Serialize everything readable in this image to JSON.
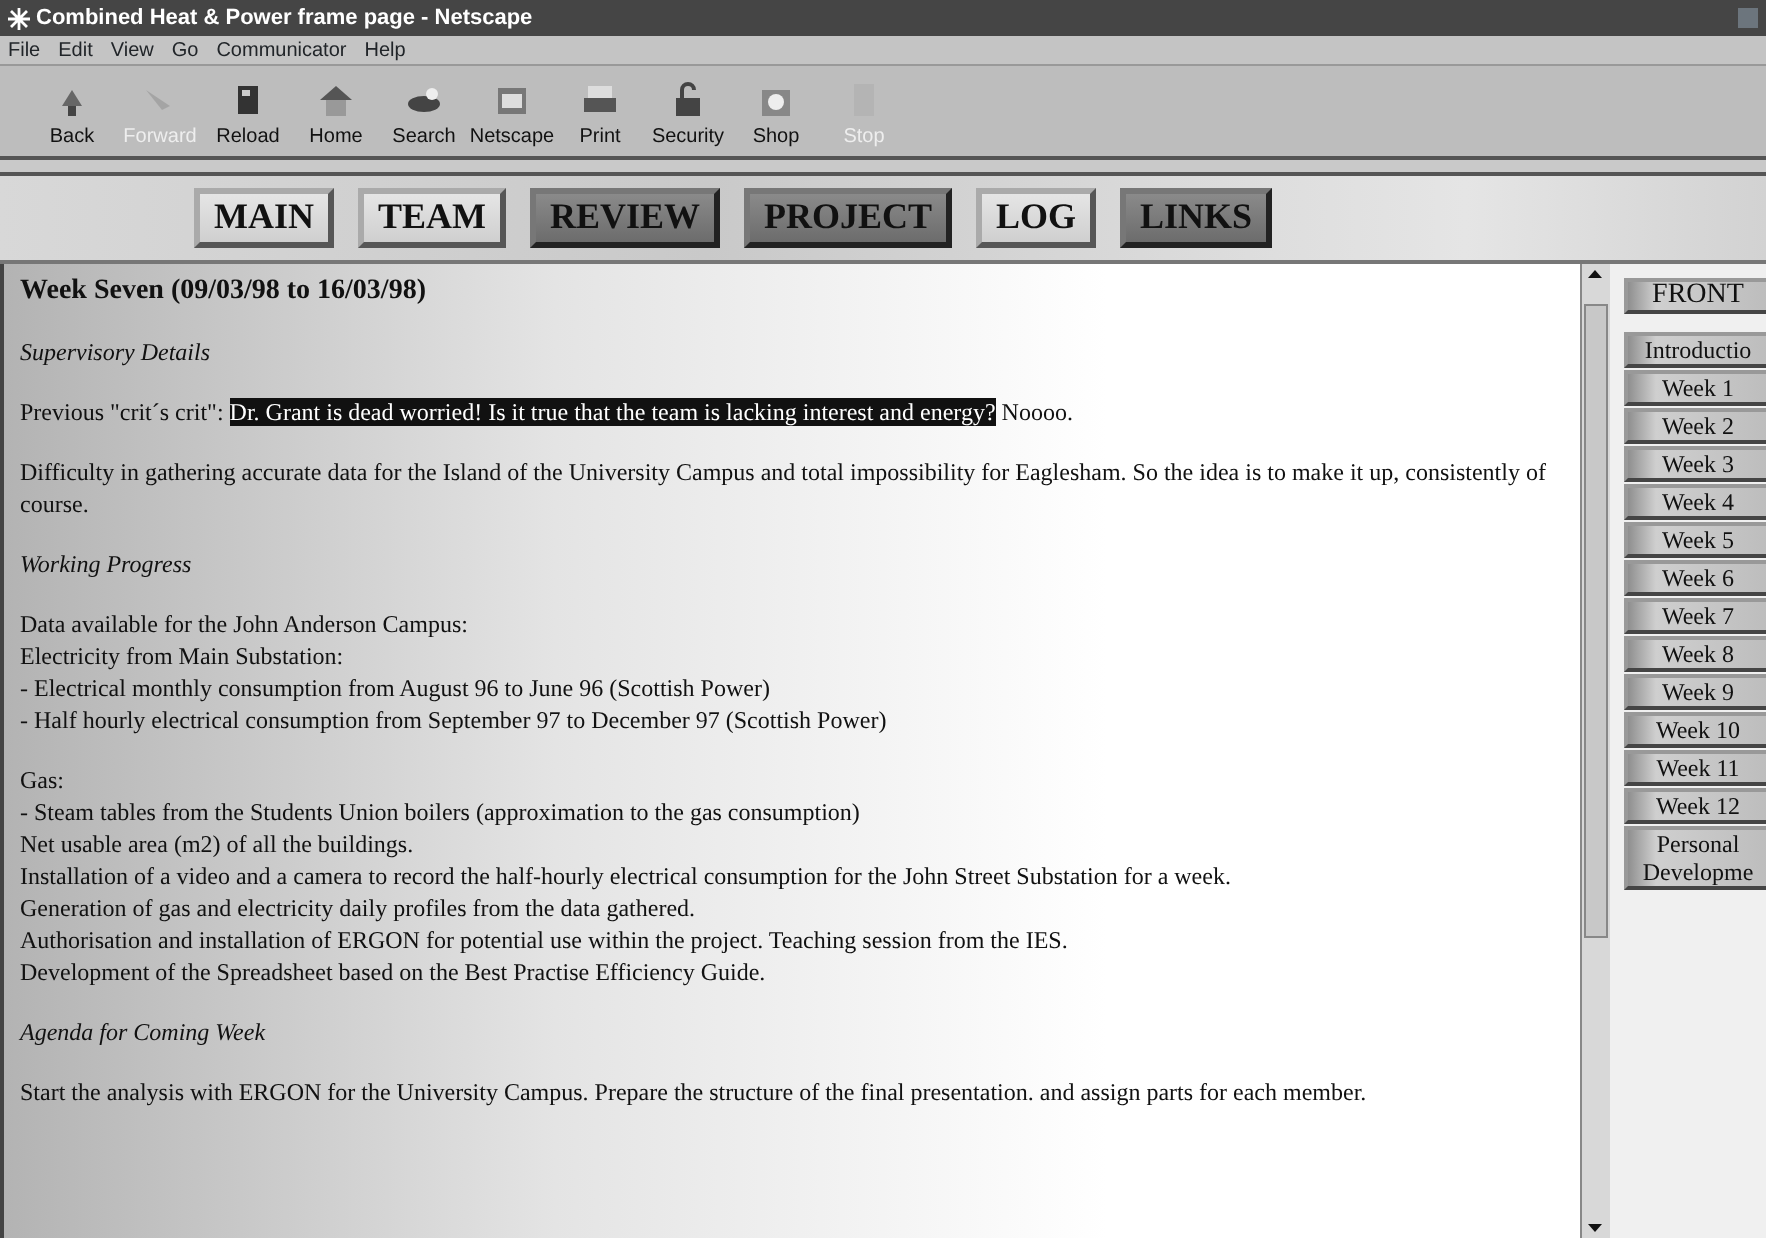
{
  "window": {
    "title": "Combined Heat & Power frame page - Netscape"
  },
  "menu": [
    "File",
    "Edit",
    "View",
    "Go",
    "Communicator",
    "Help"
  ],
  "toolbar": [
    {
      "label": "Back",
      "disabled": false
    },
    {
      "label": "Forward",
      "disabled": true
    },
    {
      "label": "Reload",
      "disabled": false
    },
    {
      "label": "Home",
      "disabled": false
    },
    {
      "label": "Search",
      "disabled": false
    },
    {
      "label": "Netscape",
      "disabled": false
    },
    {
      "label": "Print",
      "disabled": false
    },
    {
      "label": "Security",
      "disabled": false
    },
    {
      "label": "Shop",
      "disabled": false
    },
    {
      "label": "Stop",
      "disabled": true
    }
  ],
  "nav": [
    {
      "label": "MAIN",
      "kind": "light"
    },
    {
      "label": "TEAM",
      "kind": "light"
    },
    {
      "label": "REVIEW",
      "kind": "dark"
    },
    {
      "label": "PROJECT",
      "kind": "dark"
    },
    {
      "label": "LOG",
      "kind": "light"
    },
    {
      "label": "LINKS",
      "kind": "dark"
    }
  ],
  "content": [
    {
      "kind": "heading",
      "text": "Week Seven (09/03/98 to 16/03/98)"
    },
    {
      "kind": "subheading",
      "text": "Supervisory Details"
    },
    {
      "kind": "quote",
      "before": "Previous \"crit´s crit\":",
      "selected_text": "Dr. Grant is dead worried! Is it true that the team is lacking interest and energy?",
      "after": "Noooo."
    },
    {
      "kind": "paragraph",
      "text": "Difficulty in gathering accurate data for the Island of the University Campus and total impossibility for Eaglesham. So the idea is to make it up, consistently of course."
    },
    {
      "kind": "subheading",
      "text": "Working Progress"
    },
    {
      "kind": "lines",
      "lines": [
        "Data available for the John Anderson Campus:",
        "Electricity from Main Substation:",
        "- Electrical monthly consumption from August 96 to June 96 (Scottish Power)",
        "- Half hourly electrical consumption from September 97 to December 97 (Scottish Power)"
      ]
    },
    {
      "kind": "lines",
      "lines": [
        "Gas:",
        "- Steam tables from the Students Union boilers (approximation to the gas consumption)",
        "Net usable area (m2) of all the buildings.",
        "Installation of a video and a camera to record the half-hourly electrical consumption for the John Street Substation for a week.",
        "Generation of gas and electricity daily profiles from the data gathered.",
        "Authorisation and installation of ERGON for potential use within the project. Teaching session from the IES.",
        "Development of the Spreadsheet based on the Best Practise Efficiency Guide."
      ]
    },
    {
      "kind": "subheading",
      "text": "Agenda for Coming Week"
    },
    {
      "kind": "paragraph",
      "text": "Start the analysis with ERGON for the University Campus. Prepare the structure of the final presentation. and assign parts for each member."
    }
  ],
  "sidebar": {
    "title": "FRONT",
    "items": [
      "Introductio",
      "Week 1",
      "Week 2",
      "Week 3",
      "Week 4",
      "Week 5",
      "Week 6",
      "Week 7",
      "Week 8",
      "Week 9",
      "Week 10",
      "Week 11",
      "Week 12",
      "Personal Developme"
    ]
  }
}
